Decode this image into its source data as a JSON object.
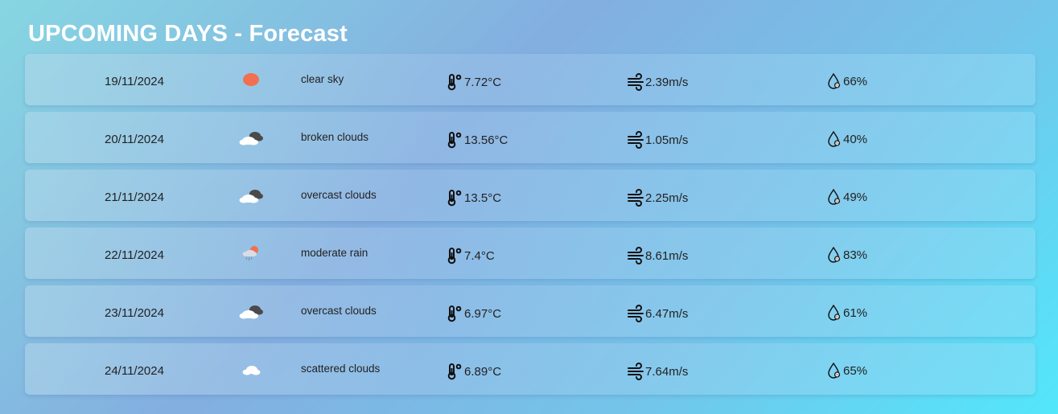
{
  "header": {
    "title": "UPCOMING DAYS - Forecast"
  },
  "forecast": [
    {
      "date": "19/11/2024",
      "icon": "sun-icon",
      "description": "clear sky",
      "temperature": "7.72°C",
      "wind": "2.39m/s",
      "humidity": "66%"
    },
    {
      "date": "20/11/2024",
      "icon": "broken-clouds-icon",
      "description": "broken clouds",
      "temperature": "13.56°C",
      "wind": "1.05m/s",
      "humidity": "40%"
    },
    {
      "date": "21/11/2024",
      "icon": "overcast-clouds-icon",
      "description": "overcast clouds",
      "temperature": "13.5°C",
      "wind": "2.25m/s",
      "humidity": "49%"
    },
    {
      "date": "22/11/2024",
      "icon": "rain-icon",
      "description": "moderate rain",
      "temperature": "7.4°C",
      "wind": "8.61m/s",
      "humidity": "83%"
    },
    {
      "date": "23/11/2024",
      "icon": "overcast-clouds-icon",
      "description": "overcast clouds",
      "temperature": "6.97°C",
      "wind": "6.47m/s",
      "humidity": "61%"
    },
    {
      "date": "24/11/2024",
      "icon": "scattered-clouds-icon",
      "description": "scattered clouds",
      "temperature": "6.89°C",
      "wind": "7.64m/s",
      "humidity": "65%"
    }
  ],
  "colors": {
    "sun": "#f07050",
    "cloud_light": "#ffffff",
    "cloud_dark": "#4a4a4a",
    "rain": "#7a8aa0"
  }
}
